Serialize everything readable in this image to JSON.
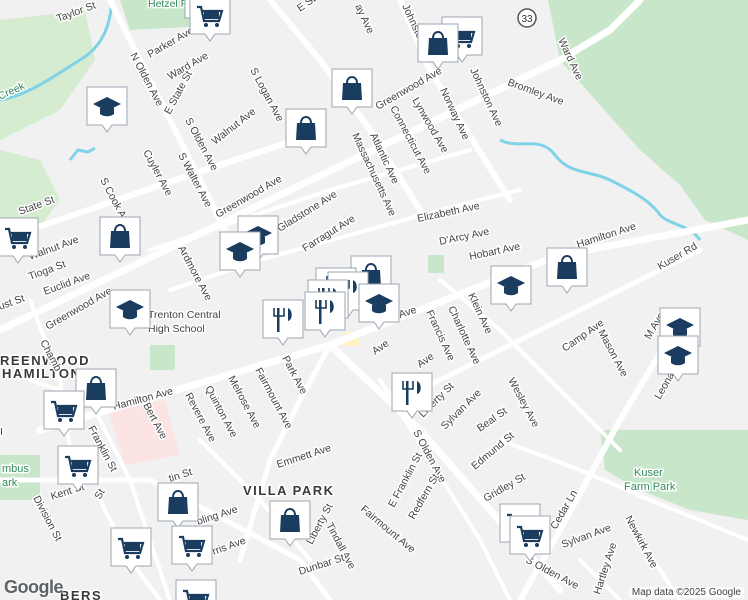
{
  "map": {
    "logo": "Google",
    "attribution": "Map data ©2025 Google",
    "route_shield": "33",
    "labels": {
      "taylor_st": "Taylor St",
      "hetzel_field": "Hetzel Field",
      "e_state_st_top": "E St",
      "ave_top": "ay Ave",
      "johnston_ave_top": "Johnston",
      "johnston_ave": "Johnston Ave",
      "ward_ave": "Ward Ave",
      "bromley_ave": "Bromley Ave",
      "parker_ave": "Parker Ave",
      "ward_ave_left": "Ward Ave",
      "n_olden_ave": "N Olden Ave",
      "e_state_st": "E State St",
      "s_logan_ave": "S Logan Ave",
      "greenwood_ave_top": "Greenwood Ave",
      "norway_ave": "Norway Ave",
      "lynwood_ave": "Lynwood Ave",
      "connecticut_ave": "Connecticut Ave",
      "creek": "Creek",
      "s_olden_ave_top": "S Olden Ave",
      "walnut_ave_top": "Walnut Ave",
      "atlantic_ave": "Atlantic Ave",
      "massachusetts_ave": "Massachusetts Ave",
      "cuyler_ave": "Cuyler Ave",
      "s_walter_ave": "S Walter Ave",
      "greenwood_ave_mid": "Greenwood Ave",
      "s_cook_ave": "S Cook Ave",
      "state_st": "State St",
      "gladstone_ave": "Gladstone Ave",
      "elizabeth_ave": "Elizabeth Ave",
      "darcy_ave": "D'Arcy Ave",
      "hamilton_ave_right": "Hamilton Ave",
      "kuser_rd": "Kuser Rd",
      "walnut_ave": "Walnut Ave",
      "farragut_ave": "Farragut Ave",
      "hobart_ave": "Hobart Ave",
      "tioga_st": "Tioga St",
      "ardmore_ave": "Ardmore Ave",
      "euclid_ave": "Euclid Ave",
      "greenwood_ave_left": "Greenwood Ave",
      "cust_st": "ust St",
      "trenton_central": "Trenton Central",
      "high_school": "High School",
      "ave_frag": "Ave",
      "klein_ave": "Klein Ave",
      "francis_ave": "Francis Ave",
      "charlotte_ave": "Charlotte Ave",
      "camp_ave": "Camp Ave",
      "mason_ave": "Mason Ave",
      "m_ave": "M Ave",
      "greenwood": "REENWOOD",
      "hamilton": "HAMILTON",
      "chambers_st": "Chamb",
      "hamilton_ave_left": "Hamilton Ave",
      "park_ave": "Park Ave",
      "fairmount_ave": "Fairmount Ave",
      "melrose_ave": "Melrose Ave",
      "quinton_ave": "Quinton Ave",
      "revere_ave": "Revere Ave",
      "bert_ave": "Bert Ave",
      "ave_small": "Ave",
      "liberty_st": "Liberty St",
      "sylvan_ave": "Sylvan Ave",
      "wesley_ave": "Wesley Ave",
      "leonard_ave": "Leonard Ave",
      "beal_st": "Beal St",
      "franklin_st": "Franklin St",
      "columbus_park": "mbus",
      "columbus_park2": "ark",
      "emmett_ave": "Emmett Ave",
      "s_olden_ave": "S Olden Ave",
      "edmund_st": "Edmund St",
      "kent_st": "Kent St",
      "st_frag": "St",
      "tin_st": "tin St",
      "e_franklin_st": "E Franklin St",
      "redfern_st": "Redfern St",
      "gridley_st": "Gridley St",
      "cedar_ln": "Cedar Ln",
      "kuser_farm": "Kuser",
      "kuser_farm2": "Farm Park",
      "division_st": "Division St",
      "villa_park": "VILLA PARK",
      "liberty_st_lower": "Liberty St",
      "fairmount_ave_lower": "Fairmount Ave",
      "tindall_ave": "Tindall Ave",
      "sylvan_ave_lower": "Sylvan Ave",
      "newkirk_ave": "Newkirk Ave",
      "hartley_ave": "Hartley Ave",
      "morris_ave": "Morris Ave",
      "dunbar_st": "Dunbar St",
      "s_olden_ave_lower": "S Olden Ave",
      "berkeley": "BERS",
      "ave_i": "I",
      "bling_ave": "bling Ave",
      "ave_o": "Ave"
    }
  },
  "colors": {
    "pin_fill": "#1a3c5e",
    "pin_bg": "#ffffff",
    "park": "#c8e6c9",
    "water": "#aadaff",
    "creek": "#7fd3e8",
    "hospital": "#fce4e4"
  },
  "markers": [
    {
      "icon": "shopping-bag-icon",
      "label": "Shopping"
    },
    {
      "icon": "shopping-cart-icon",
      "label": "Grocery"
    },
    {
      "icon": "shopping-bag-icon",
      "label": "Shopping"
    },
    {
      "icon": "shopping-bag-icon",
      "label": "Shopping"
    },
    {
      "icon": "graduation-cap-icon",
      "label": "School"
    },
    {
      "icon": "shopping-bag-icon",
      "label": "Shopping"
    },
    {
      "icon": "shopping-cart-icon",
      "label": "Grocery"
    },
    {
      "icon": "shopping-bag-icon",
      "label": "Shopping"
    },
    {
      "icon": "graduation-cap-icon",
      "label": "School"
    },
    {
      "icon": "graduation-cap-icon",
      "label": "School"
    },
    {
      "icon": "graduation-cap-icon",
      "label": "School"
    },
    {
      "icon": "shopping-bag-icon",
      "label": "Shopping"
    },
    {
      "icon": "fork-knife-icon",
      "label": "Restaurant"
    },
    {
      "icon": "fork-knife-icon",
      "label": "Restaurant"
    },
    {
      "icon": "fork-knife-icon",
      "label": "Restaurant"
    },
    {
      "icon": "graduation-cap-icon",
      "label": "School"
    },
    {
      "icon": "fork-knife-icon",
      "label": "Restaurant"
    },
    {
      "icon": "fork-knife-icon",
      "label": "Restaurant"
    },
    {
      "icon": "graduation-cap-icon",
      "label": "School"
    },
    {
      "icon": "shopping-bag-icon",
      "label": "Shopping"
    },
    {
      "icon": "graduation-cap-icon",
      "label": "School"
    },
    {
      "icon": "graduation-cap-icon",
      "label": "School"
    },
    {
      "icon": "shopping-bag-icon",
      "label": "Shopping"
    },
    {
      "icon": "shopping-cart-icon",
      "label": "Grocery"
    },
    {
      "icon": "fork-knife-icon",
      "label": "Restaurant"
    },
    {
      "icon": "shopping-cart-icon",
      "label": "Grocery"
    },
    {
      "icon": "shopping-bag-icon",
      "label": "Shopping"
    },
    {
      "icon": "shopping-bag-icon",
      "label": "Shopping"
    },
    {
      "icon": "shopping-cart-icon",
      "label": "Grocery"
    },
    {
      "icon": "shopping-cart-icon",
      "label": "Grocery"
    },
    {
      "icon": "shopping-cart-icon",
      "label": "Grocery"
    },
    {
      "icon": "shopping-cart-icon",
      "label": "Grocery"
    },
    {
      "icon": "shopping-cart-icon",
      "label": "Grocery"
    },
    {
      "icon": "shopping-cart-icon",
      "label": "Grocery"
    }
  ]
}
